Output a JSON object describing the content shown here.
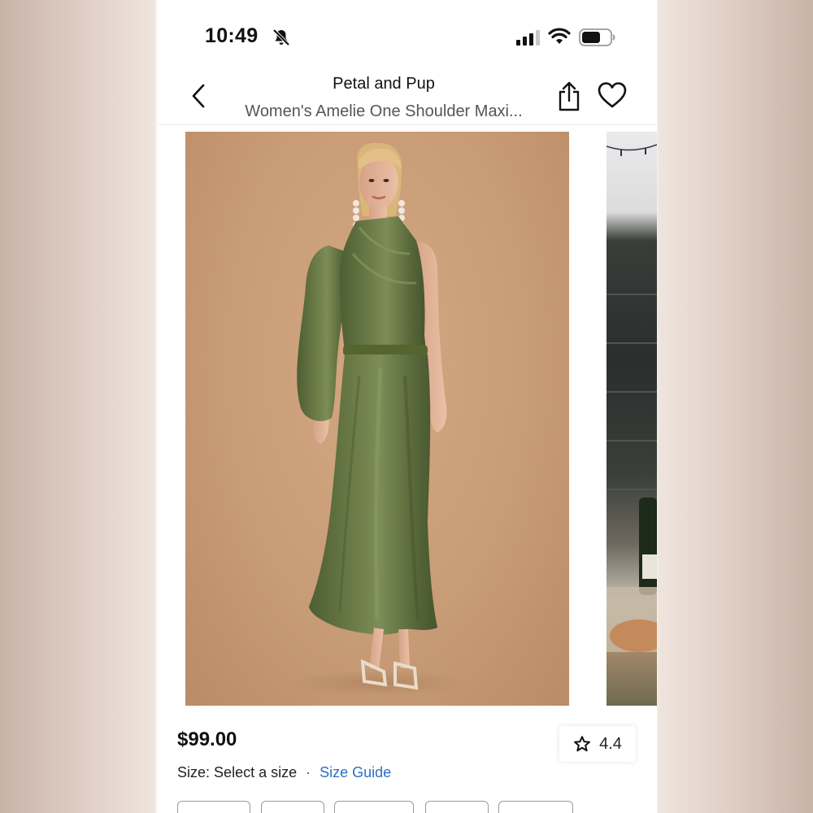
{
  "status_bar": {
    "time": "10:49",
    "icons": [
      "bell-off-icon",
      "signal-icon",
      "wifi-icon",
      "battery-icon"
    ]
  },
  "header": {
    "brand": "Petal and Pup",
    "product_title": "Women's Amelie One Shoulder Maxi...",
    "icons": [
      "back-chevron-icon",
      "share-icon",
      "heart-icon"
    ]
  },
  "gallery": {
    "images": [
      "Model wearing olive green satin one-shoulder maxi dress",
      "Outdoor rooftop scene with champagne"
    ]
  },
  "product": {
    "price": "$99.00",
    "rating": "4.4",
    "rating_icon": "star-outline-icon",
    "size_label": "Size:",
    "size_value": "Select a size",
    "size_separator": "·",
    "size_guide": "Size Guide"
  },
  "colors": {
    "link": "#2d6fc4",
    "dress": "#5f7040",
    "backdrop": "#c89c76"
  }
}
